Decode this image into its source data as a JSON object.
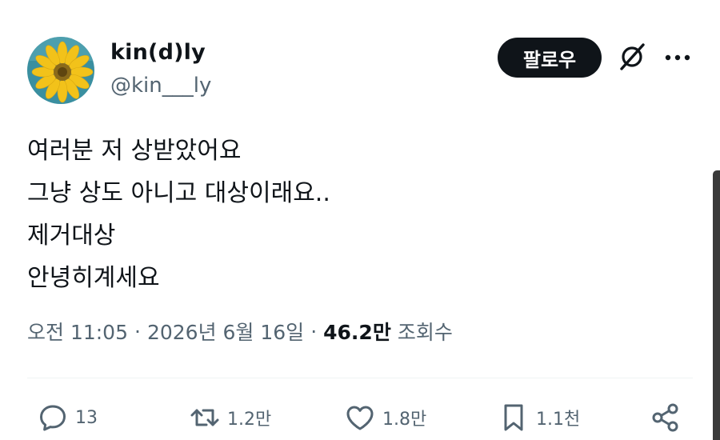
{
  "author": {
    "display_name": "kin(d)ly",
    "handle": "@kin___ly"
  },
  "header": {
    "follow_label": "팔로우",
    "icons": [
      "grok-icon",
      "more-icon"
    ]
  },
  "tweet": {
    "lines": [
      "여러분 저 상받았어요",
      "그냥 상도 아니고 대상이래요..",
      "제거대상",
      "안녕히계세요"
    ]
  },
  "meta": {
    "time": "오전 11:05",
    "date": "2026년 6월 16일",
    "views": "46.2만",
    "views_label": "조회수"
  },
  "actions": {
    "replies": "13",
    "reposts": "1.2만",
    "likes": "1.8만",
    "bookmarks": "1.1천",
    "icons": [
      "reply-icon",
      "repost-icon",
      "like-icon",
      "bookmark-icon",
      "share-icon"
    ]
  },
  "colors": {
    "text": "#0f1419",
    "secondary": "#536471",
    "button_bg": "#0f1419",
    "button_text": "#ffffff",
    "avatar_bg": "#3a8fa0",
    "sunflower_petals": "#f2c21a",
    "sunflower_center": "#8a6a1a"
  }
}
